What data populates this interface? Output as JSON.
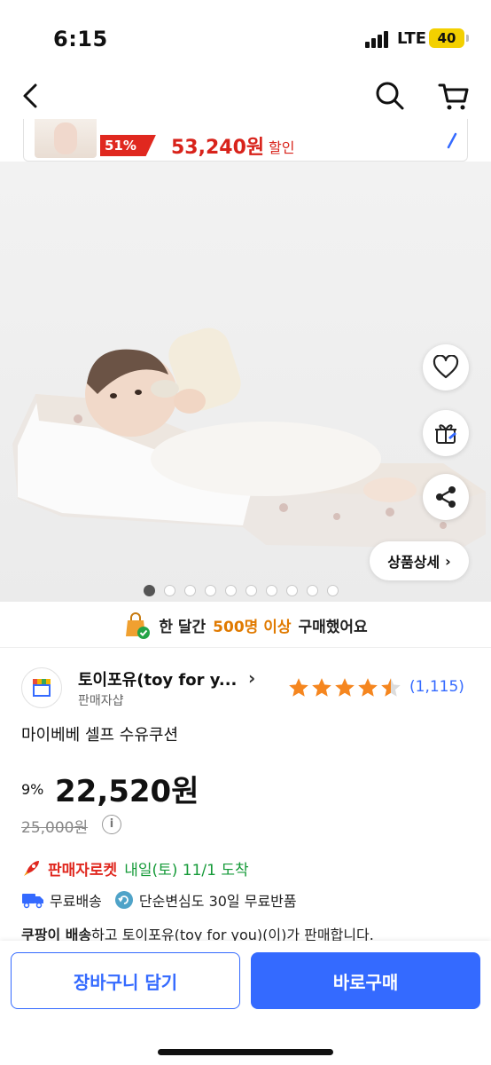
{
  "status_bar": {
    "time": "6:15",
    "network": "LTE",
    "battery": "40"
  },
  "promo": {
    "discount": "51%",
    "price": "53,240원",
    "label": "할인"
  },
  "image_gallery": {
    "page_count": 10,
    "current_index": 0
  },
  "detail_button": {
    "label": "상품상세",
    "chevron": "›"
  },
  "purchase_banner": {
    "prefix": "한 달간",
    "highlight": "500명 이상",
    "suffix": "구매했어요"
  },
  "seller": {
    "name": "토이포유(toy for y...",
    "chevron": "›",
    "subtitle": "판매자샵"
  },
  "rating": {
    "stars": 4.5,
    "review_count": "(1,115)"
  },
  "product": {
    "title": "마이베베 셀프 수유쿠션",
    "discount": "9%",
    "price": "22,520원",
    "original_price": "25,000원"
  },
  "delivery": {
    "rocket_label": "판매자로켓",
    "arrival": "내일(토) 11/1 도착",
    "free_shipping": "무료배송",
    "free_return": "단순변심도 30일 무료반품",
    "seller_note_bold": "쿠팡이 배송",
    "seller_note_rest": "하고 토이포유(toy for you)(이)가 판매합니다."
  },
  "bottom_bar": {
    "cart_button": "장바구니 담기",
    "buy_button": "바로구매"
  },
  "colors": {
    "accent": "#346aff",
    "sale_red": "#e0281f",
    "star": "#f5861f",
    "arrival_green": "#159a38"
  }
}
